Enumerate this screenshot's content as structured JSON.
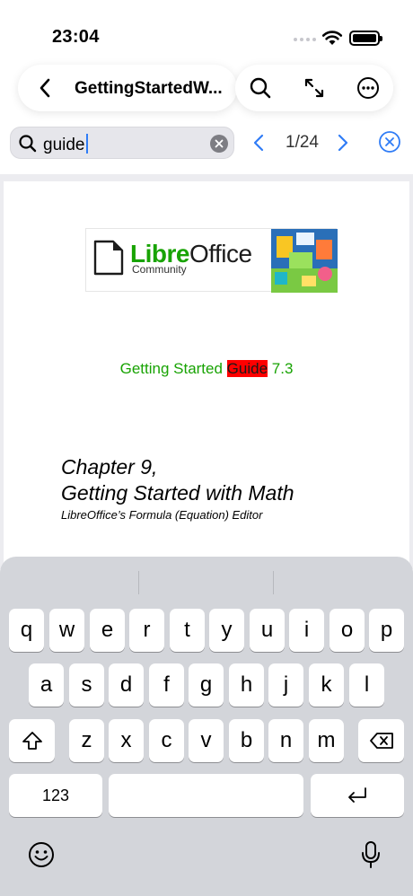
{
  "status_bar": {
    "time": "23:04"
  },
  "nav": {
    "title": "GettingStartedW..."
  },
  "search": {
    "query": "guide",
    "match_counter": "1/24"
  },
  "document": {
    "logo": {
      "name_part1": "Libre",
      "name_part2": "Office",
      "subtitle": "Community"
    },
    "subtitle_before": "Getting Started ",
    "subtitle_highlight": "Guide",
    "subtitle_after": " 7.3",
    "chapter_line1": "Chapter 9,",
    "chapter_line2": "Getting Started with Math",
    "chapter_subtitle": "LibreOffice’s Formula (Equation) Editor"
  },
  "keyboard": {
    "row1": [
      "q",
      "w",
      "e",
      "r",
      "t",
      "y",
      "u",
      "i",
      "o",
      "p"
    ],
    "row2": [
      "a",
      "s",
      "d",
      "f",
      "g",
      "h",
      "j",
      "k",
      "l"
    ],
    "row3": [
      "z",
      "x",
      "c",
      "v",
      "b",
      "n",
      "m"
    ],
    "numbers_key": "123"
  },
  "colors": {
    "accent": "#2f7cf6",
    "highlight": "#ff0000",
    "libre_green": "#18a303"
  }
}
